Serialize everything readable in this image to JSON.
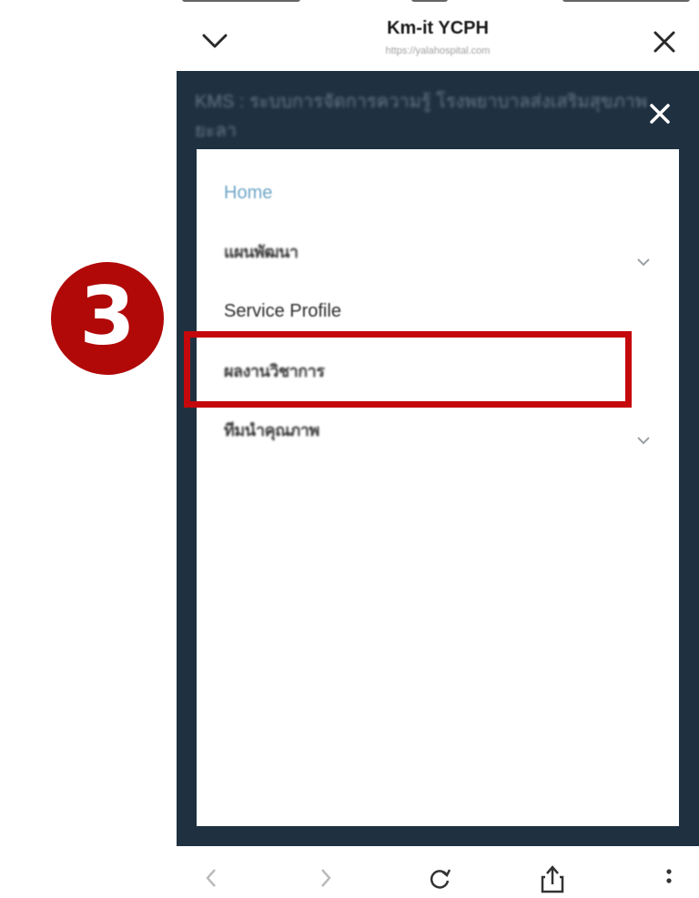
{
  "browser": {
    "title": "Km-it YCPH",
    "url": "https://yalahospital.com"
  },
  "site": {
    "header_title": "KMS : ระบบการจัดการความรู้ โรงพยาบาลส่งเสริมสุขภาพยะลา"
  },
  "menu": {
    "items": [
      {
        "label": "Home",
        "active": true,
        "has_submenu": false
      },
      {
        "label": "แผนพัฒนา",
        "active": false,
        "has_submenu": true
      },
      {
        "label": "Service Profile",
        "active": false,
        "has_submenu": false
      },
      {
        "label": "ผลงานวิชาการ",
        "active": false,
        "has_submenu": false,
        "highlighted": true
      },
      {
        "label": "ทีมนำคุณภาพ",
        "active": false,
        "has_submenu": true
      }
    ]
  },
  "annotation": {
    "step_number": "3",
    "step_color": "#b10808",
    "highlight_color": "#c5080c"
  },
  "colors": {
    "overlay": "#1f3140",
    "active_link": "#6fa6c7"
  },
  "icons": {
    "header_left": "chevron-down-icon",
    "header_right": "close-icon",
    "overlay_close": "close-icon",
    "nav": [
      "back-icon",
      "forward-icon",
      "reload-icon",
      "share-icon",
      "more-icon"
    ]
  }
}
